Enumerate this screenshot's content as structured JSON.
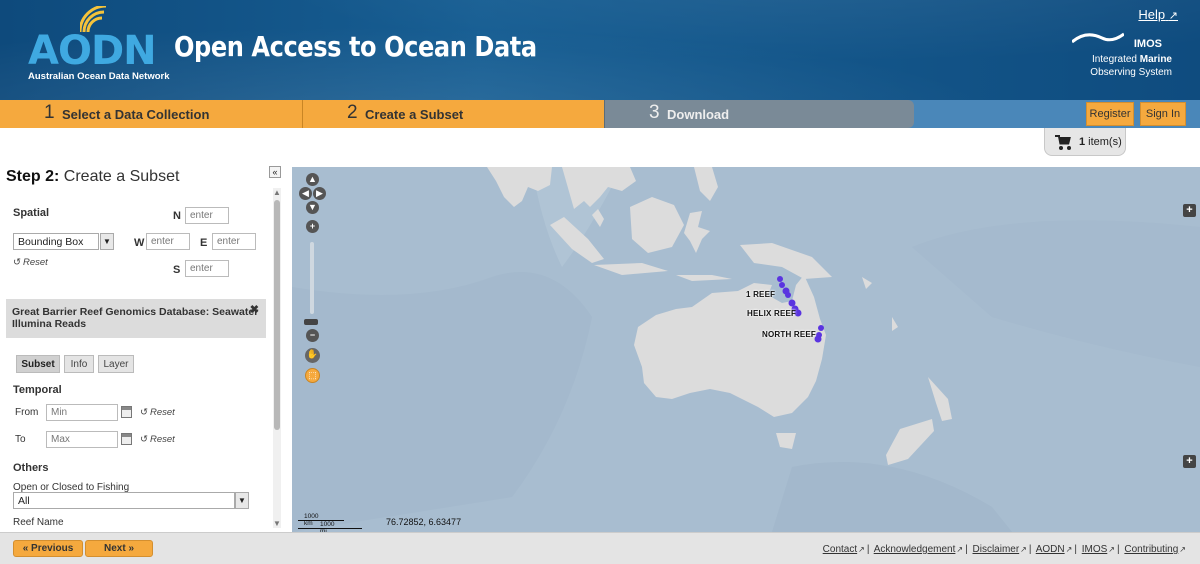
{
  "header": {
    "logo_text": "AODN",
    "logo_subtitle": "Australian Ocean Data Network",
    "site_title": "Open Access to Ocean Data",
    "help_label": "Help",
    "imos": {
      "name": "IMOS",
      "line1": "Integrated",
      "line1_bold": "Marine",
      "line2": "Observing System"
    }
  },
  "steps": [
    {
      "num": "1",
      "label": "Select a Data Collection"
    },
    {
      "num": "2",
      "label": "Create a Subset"
    },
    {
      "num": "3",
      "label": "Download"
    }
  ],
  "auth": {
    "register": "Register",
    "signin": "Sign In"
  },
  "cart": {
    "count": "1",
    "suffix": "item(s)"
  },
  "panel": {
    "title_bold": "Step 2:",
    "title_rest": "Create a Subset",
    "collapse": "«",
    "spatial": {
      "label": "Spatial",
      "mode": "Bounding Box",
      "n_label": "N",
      "s_label": "S",
      "e_label": "E",
      "w_label": "W",
      "placeholder": "enter",
      "reset": "Reset"
    },
    "collection": {
      "name": "Great Barrier Reef Genomics Database: Seawater Illumina Reads",
      "close": "✖"
    },
    "tabs": [
      "Subset",
      "Info",
      "Layer"
    ],
    "temporal": {
      "label": "Temporal",
      "from_label": "From",
      "to_label": "To",
      "from_placeholder": "Min",
      "to_placeholder": "Max",
      "reset": "Reset"
    },
    "others": {
      "label": "Others",
      "fishing_label": "Open or Closed to Fishing",
      "fishing_value": "All",
      "reef_label": "Reef Name"
    }
  },
  "map": {
    "reef_labels": [
      "1 REEF",
      "HELIX REEF",
      "NORTH REEF"
    ],
    "scale_km": "1000 km",
    "scale_mi": "1000 mi",
    "coordinates": "76.72852, 6.63477",
    "ocean_color": "#a8bdd0",
    "land_color": "#dcdcdc",
    "marker_color": "#5a34e0"
  },
  "nav": {
    "previous": "« Previous",
    "next": "Next »"
  },
  "footer_links": [
    "Contact",
    "Acknowledgement",
    "Disclaimer",
    "AODN",
    "IMOS",
    "Contributing"
  ]
}
